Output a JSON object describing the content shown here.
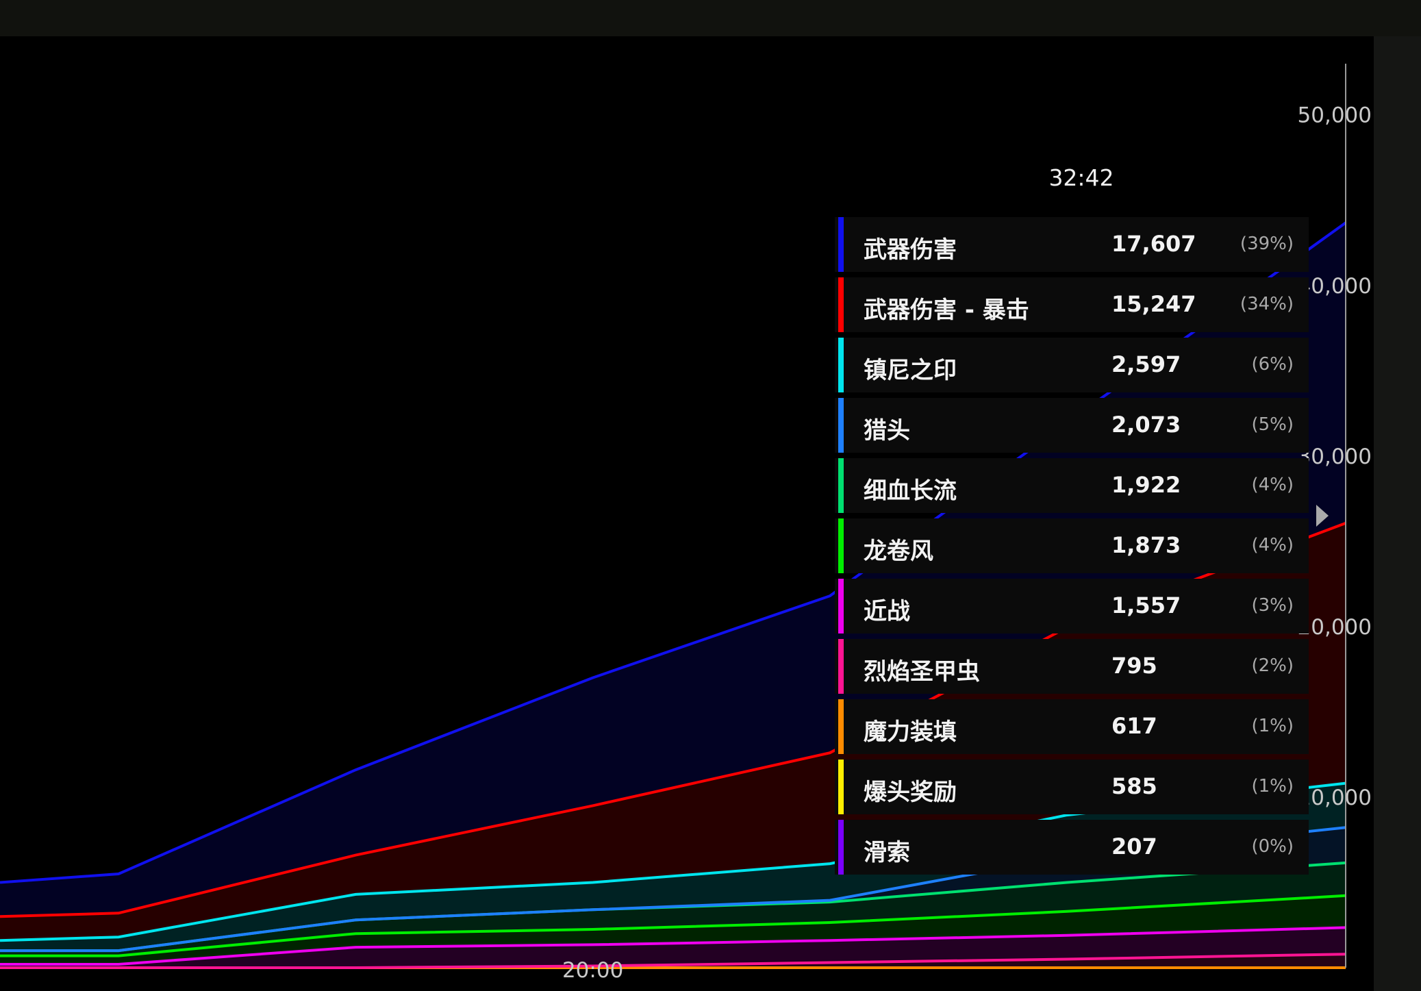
{
  "chart_data": {
    "type": "area",
    "stacked": true,
    "ylim": [
      0,
      50000
    ],
    "yticks": [
      "50,000",
      "40,000",
      "30,000",
      "20,000",
      "10,000"
    ],
    "xticks": [
      "20:00"
    ],
    "x": [
      10,
      12,
      16,
      20,
      24,
      28,
      32.7
    ],
    "series": [
      {
        "name": "滑索",
        "color": "#6a00ff",
        "values": [
          0,
          0,
          0,
          0,
          0,
          0,
          0
        ]
      },
      {
        "name": "爆头奖励",
        "color": "#ffee00",
        "values": [
          0,
          0,
          0,
          0,
          0,
          0,
          0
        ]
      },
      {
        "name": "魔力装填",
        "color": "#ff8c00",
        "values": [
          0,
          0,
          0,
          0,
          0,
          0,
          0
        ]
      },
      {
        "name": "烈焰圣甲虫",
        "color": "#ff1493",
        "values": [
          0,
          0,
          0,
          100,
          300,
          500,
          795
        ]
      },
      {
        "name": "近战",
        "color": "#ee00ee",
        "values": [
          200,
          200,
          1200,
          1250,
          1300,
          1400,
          1557
        ]
      },
      {
        "name": "龙卷风",
        "color": "#00ee00",
        "values": [
          500,
          500,
          800,
          900,
          1050,
          1400,
          1873
        ]
      },
      {
        "name": "细血长流",
        "color": "#00e070",
        "values": [
          300,
          300,
          800,
          1150,
          1200,
          1700,
          1922
        ]
      },
      {
        "name": "猎头",
        "color": "#1e80ff",
        "values": [
          0,
          0,
          0,
          0,
          100,
          1500,
          2073
        ]
      },
      {
        "name": "镇尼之印",
        "color": "#00e5ee",
        "values": [
          600,
          800,
          1500,
          1600,
          2150,
          2450,
          2597
        ]
      },
      {
        "name": "武器伤害 - 暴击",
        "color": "#ff0000",
        "values": [
          1400,
          1400,
          2300,
          4500,
          6500,
          11000,
          15247
        ]
      },
      {
        "name": "武器伤害",
        "color": "#1010ee",
        "values": [
          2000,
          2300,
          5000,
          7500,
          9200,
          12000,
          17607
        ]
      }
    ]
  },
  "tooltip": {
    "time": "32:42",
    "rows": [
      {
        "name": "武器伤害",
        "value": "17,607",
        "pct": "(39%)",
        "color": "#1010ee"
      },
      {
        "name": "武器伤害 - 暴击",
        "value": "15,247",
        "pct": "(34%)",
        "color": "#ff0000"
      },
      {
        "name": "镇尼之印",
        "value": "2,597",
        "pct": "(6%)",
        "color": "#00e5ee"
      },
      {
        "name": "猎头",
        "value": "2,073",
        "pct": "(5%)",
        "color": "#1e80ff"
      },
      {
        "name": "细血长流",
        "value": "1,922",
        "pct": "(4%)",
        "color": "#00e070"
      },
      {
        "name": "龙卷风",
        "value": "1,873",
        "pct": "(4%)",
        "color": "#00ee00"
      },
      {
        "name": "近战",
        "value": "1,557",
        "pct": "(3%)",
        "color": "#ee00ee"
      },
      {
        "name": "烈焰圣甲虫",
        "value": "795",
        "pct": "(2%)",
        "color": "#ff1493"
      },
      {
        "name": "魔力装填",
        "value": "617",
        "pct": "(1%)",
        "color": "#ff8c00"
      },
      {
        "name": "爆头奖励",
        "value": "585",
        "pct": "(1%)",
        "color": "#ffee00"
      },
      {
        "name": "滑索",
        "value": "207",
        "pct": "(0%)",
        "color": "#7a00ff"
      }
    ]
  }
}
